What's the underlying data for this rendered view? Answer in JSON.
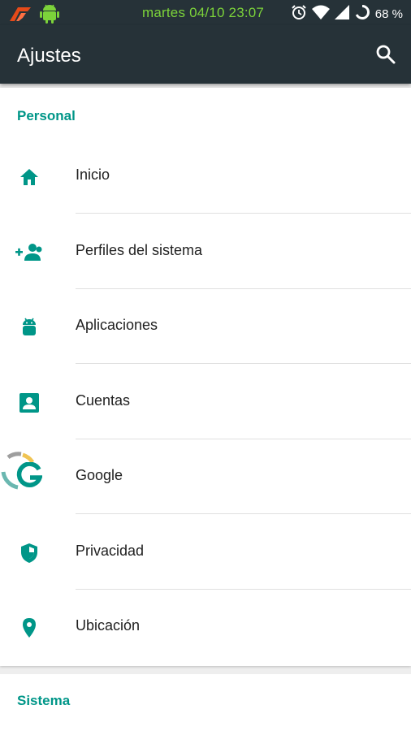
{
  "status_bar": {
    "datetime": "martes 04/10 23:07",
    "battery": "68 %",
    "icons": [
      "app-notification-icon",
      "android-icon",
      "alarm-icon",
      "wifi-icon",
      "signal-icon",
      "battery-icon"
    ]
  },
  "toolbar": {
    "title": "Ajustes",
    "search_icon": "search-icon"
  },
  "sections": [
    {
      "title": "Personal",
      "items": [
        {
          "label": "Inicio",
          "icon": "home-icon"
        },
        {
          "label": "Perfiles del sistema",
          "icon": "add-people-icon"
        },
        {
          "label": "Aplicaciones",
          "icon": "android-icon"
        },
        {
          "label": "Cuentas",
          "icon": "account-box-icon"
        },
        {
          "label": "Google",
          "icon": "google-icon"
        },
        {
          "label": "Privacidad",
          "icon": "shield-icon"
        },
        {
          "label": "Ubicación",
          "icon": "location-pin-icon"
        }
      ]
    },
    {
      "title": "Sistema",
      "items": []
    }
  ],
  "colors": {
    "toolbar": "#263238",
    "accent": "#009688",
    "status_time": "#7cd33a"
  }
}
